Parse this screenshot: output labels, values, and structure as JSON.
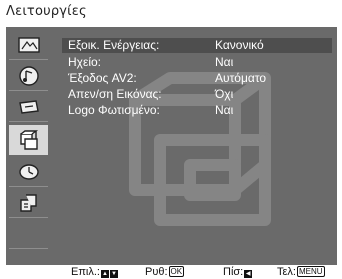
{
  "title": "Λειτουργίες",
  "menu_items": [
    {
      "label": "Εξοικ. Ενέργειας:",
      "value": "Κανονικό",
      "selected": true
    },
    {
      "label": "Ηχείο:",
      "value": "Ναι",
      "selected": false
    },
    {
      "label": "Έξοδος AV2:",
      "value": "Αυτόματο",
      "selected": false
    },
    {
      "label": "Απεν/ση Εικόνας:",
      "value": "Όχι",
      "selected": false
    },
    {
      "label": "Logo Φωτισμένο:",
      "value": "Ναι",
      "selected": false
    }
  ],
  "sidebar_tabs": [
    {
      "icon": "picture-icon",
      "active": false
    },
    {
      "icon": "sound-icon",
      "active": false
    },
    {
      "icon": "screen-icon",
      "active": false
    },
    {
      "icon": "features-icon",
      "active": true
    },
    {
      "icon": "setup-icon",
      "active": false
    },
    {
      "icon": "pc-icon",
      "active": false
    },
    {
      "icon": "",
      "active": false
    }
  ],
  "footer": {
    "select_label": "Επιλ.:",
    "adjust_label": "Ρυθ:",
    "adjust_key": "OK",
    "back_label": "Πίσ:",
    "exit_label": "Τελ:",
    "exit_key": "MENU"
  },
  "colors": {
    "panel": "#6a6a6a",
    "selected_row": "#4e4e4e",
    "active_tab": "#d9d9d9",
    "text": "#ffffff"
  }
}
